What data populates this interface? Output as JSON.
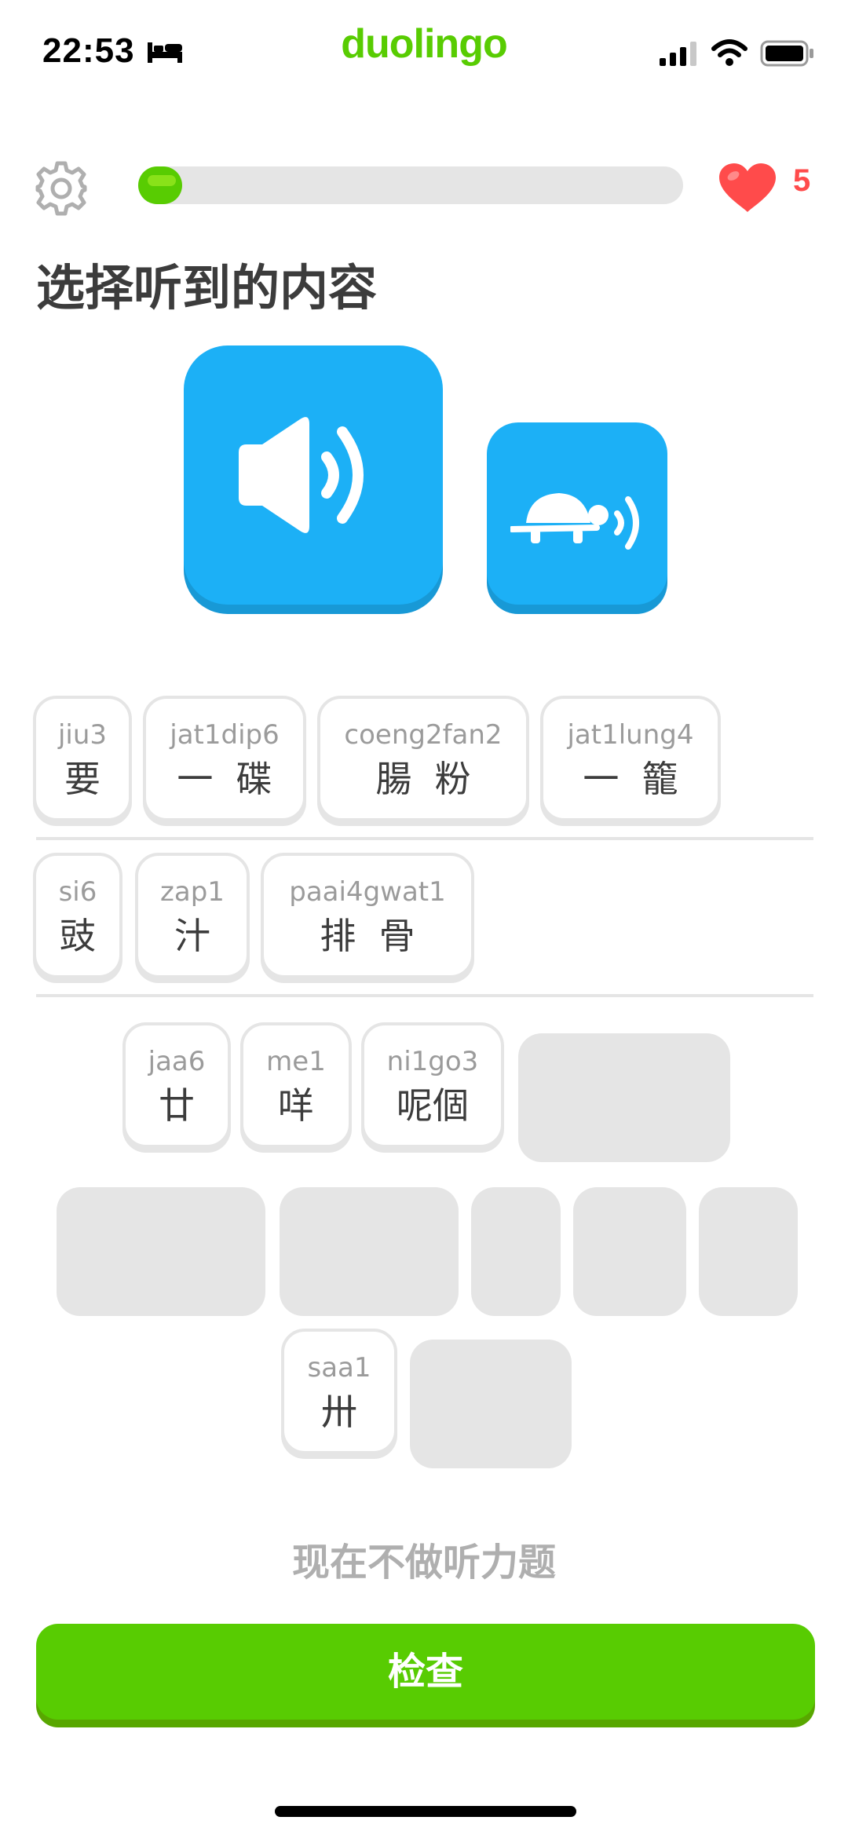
{
  "status_bar": {
    "time": "22:53"
  },
  "brand": "duolingo",
  "header": {
    "progress": 0.08,
    "hearts": "5"
  },
  "prompt": {
    "title": "选择听到的内容"
  },
  "answer_tiles": [
    {
      "romanization": "jiu3",
      "chinese": "要"
    },
    {
      "romanization": "jat1dip6",
      "chinese": "一  碟"
    },
    {
      "romanization": "coeng2fan2",
      "chinese": "腸  粉"
    },
    {
      "romanization": "jat1lung4",
      "chinese": "一  籠"
    },
    {
      "romanization": "si6",
      "chinese": "豉"
    },
    {
      "romanization": "zap1",
      "chinese": "汁"
    },
    {
      "romanization": "paai4gwat1",
      "chinese": "排  骨"
    }
  ],
  "word_bank_tiles": [
    {
      "romanization": "jaa6",
      "chinese": "廿"
    },
    {
      "romanization": "me1",
      "chinese": "咩"
    },
    {
      "romanization": "ni1go3",
      "chinese": "呢個"
    },
    {
      "romanization": "saa1",
      "chinese": "卅"
    }
  ],
  "actions": {
    "skip": "现在不做听力题",
    "check": "检查"
  },
  "colors": {
    "primary": "#58cc02",
    "audio": "#1cb0f6",
    "heart": "#ff4b4b"
  },
  "icons": [
    "bed-icon",
    "signal-icon",
    "wifi-icon",
    "battery-icon",
    "gear-icon",
    "heart-icon",
    "speaker-icon",
    "turtle-icon"
  ]
}
